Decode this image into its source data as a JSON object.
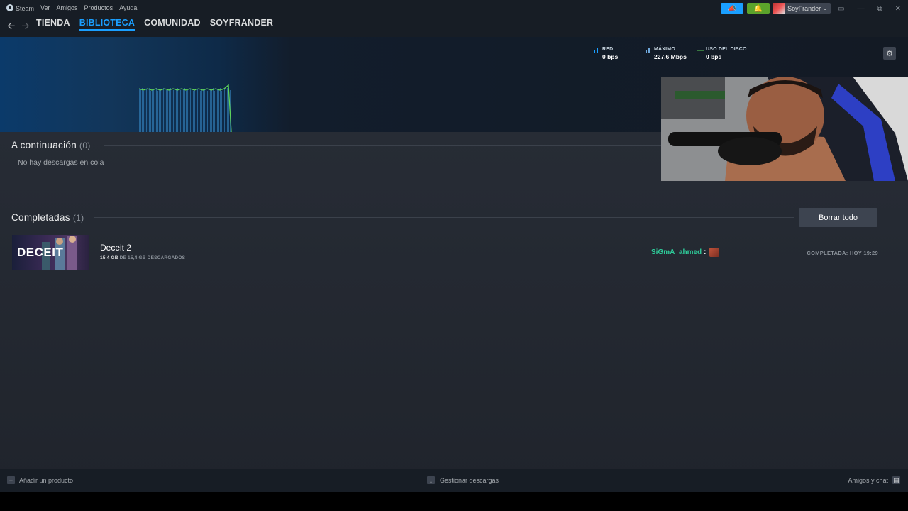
{
  "titlebar": {
    "menu": [
      "Steam",
      "Ver",
      "Amigos",
      "Productos",
      "Ayuda"
    ],
    "announce_icon": "megaphone-icon",
    "notif_icon": "bell-icon",
    "username": "SoyFrander",
    "colors": {
      "announce": "#1a9fff",
      "notif": "#5ba32b"
    }
  },
  "nav": {
    "links": [
      "TIENDA",
      "BIBLIOTECA",
      "COMUNIDAD",
      "SOYFRANDER"
    ],
    "active": "BIBLIOTECA"
  },
  "stats": {
    "network": {
      "label": "RED",
      "value": "0 bps"
    },
    "peak": {
      "label": "MÁXIMO",
      "value": "227,6 Mbps"
    },
    "disk": {
      "label": "USO DEL DISCO",
      "value": "0 bps"
    }
  },
  "queue": {
    "title": "A continuación",
    "count": "(0)",
    "empty_message": "No hay descargas en cola"
  },
  "completed": {
    "title": "Completadas",
    "count": "(1)",
    "clear_label": "Borrar todo",
    "items": [
      {
        "thumb_text": "DECEIT",
        "name": "Deceit 2",
        "downloaded": "15,4 GB",
        "size_text": "DE 15,4 GB DESCARGADOS",
        "status": "COMPLETADA: HOY 19:29"
      }
    ]
  },
  "chat_overlay": {
    "user": "SiGmA_ahmed",
    "separator": ":"
  },
  "footer": {
    "add_product": "Añadir un producto",
    "manage_downloads": "Gestionar descargas",
    "friends_chat": "Amigos y chat"
  }
}
